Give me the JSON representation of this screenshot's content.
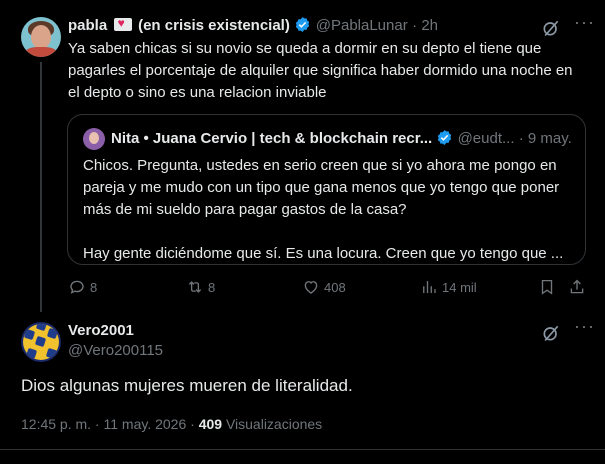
{
  "tweet": {
    "author_name": "pabla",
    "author_name_suffix": "(en crisis existencial)",
    "author_handle": "@PablaLunar",
    "time": "· 2h",
    "text": "Ya saben chicas si su novio se queda a dormir en su depto el tiene que pagarles el porcentaje de alquiler que significa haber dormido una noche en el depto o sino es una relacion inviable",
    "quote": {
      "author_name": "Nita • Juana Cervio | tech & blockchain recr...",
      "author_handle": "@eudt...",
      "time": "· 9 may.",
      "text_p1": "Chicos. Pregunta, ustedes en serio creen que si yo ahora me pongo en pareja y me mudo con un tipo que gana menos que yo tengo que poner más de mi sueldo para pagar gastos de la casa?",
      "text_p2": "Hay gente diciéndome que sí. Es una locura. Creen que yo tengo que ..."
    },
    "actions": {
      "replies": "8",
      "retweets": "8",
      "likes": "408",
      "views": "14 mil"
    }
  },
  "reply": {
    "author_name": "Vero2001",
    "author_handle": "@Vero200115",
    "text": "Dios algunas mujeres mueren de literalidad.",
    "timestamp": "12:45 p. m. · 11 may. 2026 ·",
    "views_count": "409",
    "views_label": "Visualizaciones"
  },
  "colors": {
    "background": "#000000",
    "text": "#e7e9ea",
    "muted": "#71767b",
    "verified": "#1d9bf0",
    "border": "#2f3336"
  }
}
